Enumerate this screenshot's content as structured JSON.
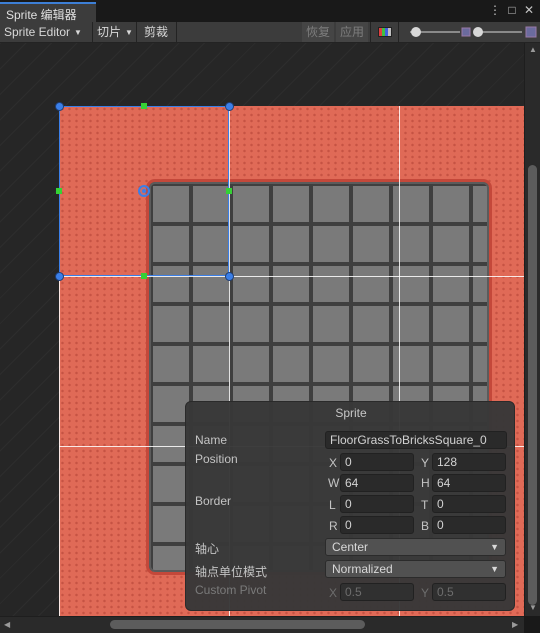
{
  "window": {
    "tab_title": "Sprite 编辑器",
    "menu_icon": "kebab-icon",
    "maximize_icon": "maximize-icon",
    "close_icon": "close-icon"
  },
  "toolbar": {
    "mode_label": "Sprite Editor",
    "slice_label": "切片",
    "trim_label": "剪裁",
    "revert_label": "恢复",
    "apply_label": "应用",
    "color_channel_icon": "color-channel-icon",
    "zoom_level": 0.1
  },
  "sprite_panel": {
    "title": "Sprite",
    "name_label": "Name",
    "name_value": "FloorGrassToBricksSquare_0",
    "position_label": "Position",
    "position": {
      "x_label": "X",
      "x": "0",
      "y_label": "Y",
      "y": "128",
      "w_label": "W",
      "w": "64",
      "h_label": "H",
      "h": "64"
    },
    "border_label": "Border",
    "border": {
      "l_label": "L",
      "l": "0",
      "t_label": "T",
      "t": "0",
      "r_label": "R",
      "r": "0",
      "b_label": "B",
      "b": "0"
    },
    "pivot_label": "轴心",
    "pivot_value": "Center",
    "pivot_unit_label": "轴点单位模式",
    "pivot_unit_value": "Normalized",
    "custom_pivot_label": "Custom Pivot",
    "custom_pivot": {
      "x_label": "X",
      "x": "0.5",
      "y_label": "Y",
      "y": "0.5"
    }
  },
  "colors": {
    "accent": "#3d7fd6",
    "selection": "#3b7fe8",
    "mid_handle": "#35d235"
  }
}
